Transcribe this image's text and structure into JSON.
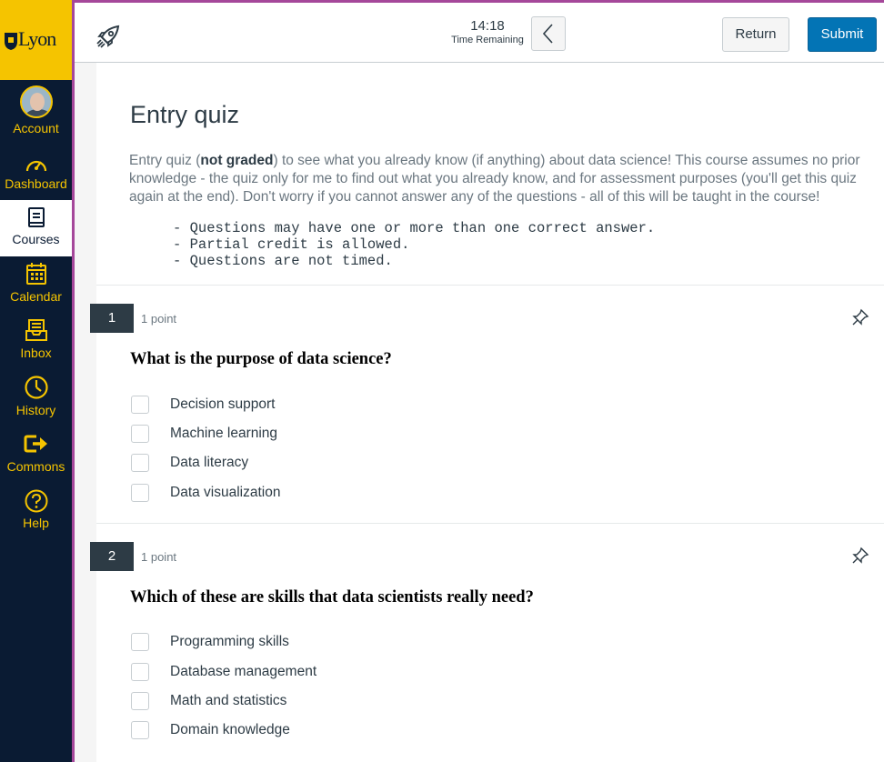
{
  "nav": {
    "logo_text": "Lyon",
    "items": [
      {
        "label": "Account",
        "icon": "avatar"
      },
      {
        "label": "Dashboard",
        "icon": "dashboard-icon"
      },
      {
        "label": "Courses",
        "icon": "courses-icon"
      },
      {
        "label": "Calendar",
        "icon": "calendar-icon"
      },
      {
        "label": "Inbox",
        "icon": "inbox-icon"
      },
      {
        "label": "History",
        "icon": "history-icon"
      },
      {
        "label": "Commons",
        "icon": "commons-icon"
      },
      {
        "label": "Help",
        "icon": "help-icon"
      }
    ],
    "active": "Courses",
    "colors": {
      "nav_bg": "#0a1b33",
      "accent": "#f5c400",
      "edge": "#a5479a"
    }
  },
  "topbar": {
    "timer_value": "14:18",
    "timer_label": "Time Remaining",
    "return_label": "Return",
    "submit_label": "Submit",
    "submit_color": "#0374b5"
  },
  "quiz": {
    "title": "Entry quiz",
    "intro_before": "Entry quiz (",
    "intro_bold": "not graded",
    "intro_after": ") to see what you already know (if anything) about data science! This course assumes no prior knowledge - the quiz only for me to find out what you already know, and for assessment purposes (you'll get this quiz again at the end). Don't worry if you cannot answer any of the questions - all of this will be taught in the course!",
    "notes": [
      "- Questions may have one or more than one correct answer.",
      "- Partial credit is allowed.",
      "- Questions are not timed."
    ],
    "questions": [
      {
        "number": "1",
        "points": "1 point",
        "text": "What is the purpose of data science?",
        "answers": [
          "Decision support",
          "Machine learning",
          "Data literacy",
          "Data visualization"
        ]
      },
      {
        "number": "2",
        "points": "1 point",
        "text": "Which of these are skills that data scientists really need?",
        "answers": [
          "Programming skills",
          "Database management",
          "Math and statistics",
          "Domain knowledge"
        ]
      }
    ]
  }
}
